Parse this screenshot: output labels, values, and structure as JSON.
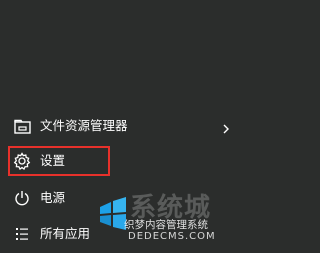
{
  "start_menu": {
    "items": [
      {
        "label": "文件资源管理器",
        "icon": "folder-icon",
        "has_submenu": true
      },
      {
        "label": "设置",
        "icon": "gear-icon",
        "highlighted": true
      },
      {
        "label": "电源",
        "icon": "power-icon"
      },
      {
        "label": "所有应用",
        "icon": "list-icon"
      }
    ]
  },
  "colors": {
    "background": "#2b2d2c",
    "highlight_border": "#e8312b",
    "text": "#ffffff"
  },
  "watermark": {
    "title": "系统城",
    "subtitle": "织梦内容管理系统",
    "url": "DEDECMS.COM"
  }
}
